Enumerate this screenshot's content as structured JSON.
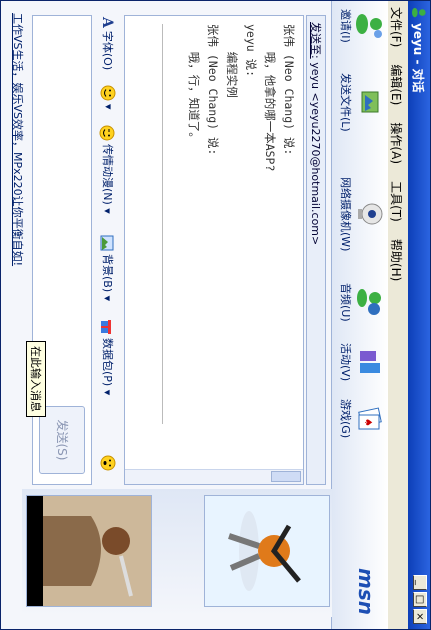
{
  "window": {
    "title": "yeyu - 对话"
  },
  "menu": [
    "文件(F)",
    "编辑(E)",
    "操作(A)",
    "工具(T)",
    "帮助(H)"
  ],
  "toolbar": {
    "buttons": [
      {
        "label": "邀请(I)",
        "icon": "invite-person-icon"
      },
      {
        "label": "发送文件(L)",
        "icon": "send-file-icon"
      },
      {
        "label": "网络摄像机(W)",
        "icon": "webcam-icon"
      },
      {
        "label": "音频(U)",
        "icon": "audio-icon"
      },
      {
        "label": "活动(V)",
        "icon": "activity-icon"
      },
      {
        "label": "游戏(G)",
        "icon": "games-icon"
      }
    ],
    "logo": "msn"
  },
  "conversation": {
    "to_label": "发送至:",
    "to_value": "yeyu <yeyu2270@hotmail.com>",
    "lines": [
      "张伟 (Neo Chang) 说:",
      "    哦，他拿的哪一本ASP?",
      "yeyu 说:",
      "    编程实例",
      "张伟 (Neo Chang) 说:",
      "    哦，行，知道了。"
    ]
  },
  "format_bar": {
    "font": "字体(O)",
    "emoticon_arrow": "▾",
    "animated": "传情动漫(N)",
    "background": "背景(B)",
    "gift": "数据包(P)"
  },
  "send_button": "发送(S)",
  "tooltip": "在此输入消息",
  "status_text": "工作VS生活，娱乐VS效率，MPx220让你平衡自如!",
  "colors": {
    "title_bar": "#0d3fb8",
    "accent": "#1d4fb4"
  }
}
